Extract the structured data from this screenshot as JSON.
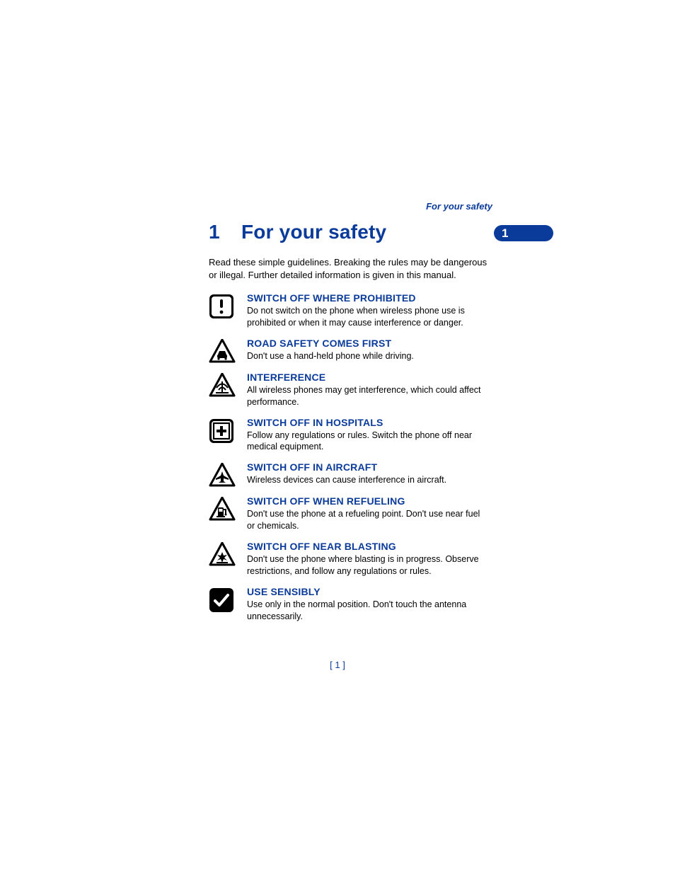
{
  "running_header": "For your safety",
  "badge": {
    "number": "1"
  },
  "chapter": {
    "number": "1",
    "title": "For your safety"
  },
  "intro": "Read these simple guidelines. Breaking the rules may be dangerous or illegal. Further detailed information is given in this manual.",
  "items": [
    {
      "title": "SWITCH OFF WHERE PROHIBITED",
      "body": "Do not switch on the phone when wireless phone use is prohibited or when it may cause interference or danger."
    },
    {
      "title": "ROAD SAFETY COMES FIRST",
      "body": "Don't use a hand-held phone while driving."
    },
    {
      "title": "INTERFERENCE",
      "body": "All wireless phones may get interference, which could affect performance."
    },
    {
      "title": "SWITCH OFF IN HOSPITALS",
      "body": "Follow any regulations or rules. Switch the phone off near medical equipment."
    },
    {
      "title": "SWITCH OFF IN AIRCRAFT",
      "body": "Wireless devices can cause interference in aircraft."
    },
    {
      "title": "SWITCH OFF WHEN REFUELING",
      "body": "Don't use the phone at a refueling point. Don't use near fuel or chemicals."
    },
    {
      "title": "SWITCH OFF NEAR BLASTING",
      "body": "Don't use the phone where blasting is in progress. Observe restrictions, and follow any regulations or rules."
    },
    {
      "title": "USE SENSIBLY",
      "body": "Use only in the normal position. Don't touch the antenna unnecessarily."
    }
  ],
  "page_number": "[ 1 ]"
}
